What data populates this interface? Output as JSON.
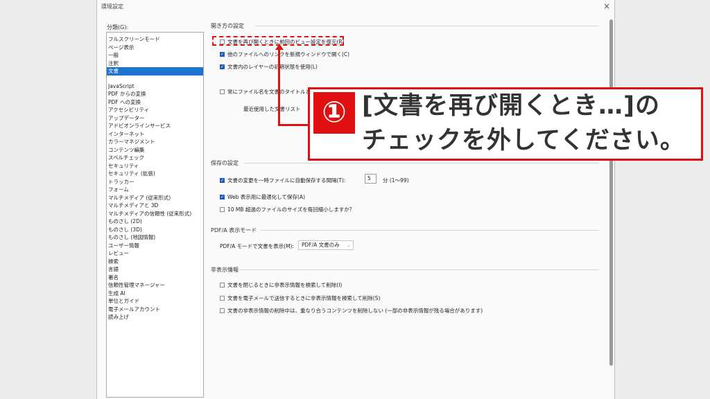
{
  "window": {
    "title": "環境設定",
    "close_glyph": "×"
  },
  "categories": {
    "label": "分類(G):",
    "top_items": [
      "フルスクリーンモード",
      "ページ表示",
      "一般",
      "注釈",
      "文書"
    ],
    "selected": "文書",
    "items": [
      "JavaScript",
      "PDF からの変換",
      "PDF への変換",
      "アクセシビリティ",
      "アップデーター",
      "アドビオンラインサービス",
      "インターネット",
      "カラーマネジメント",
      "コンテンツ編集",
      "スペルチェック",
      "セキュリティ",
      "セキュリティ (拡張)",
      "トラッカー",
      "フォーム",
      "マルチメディア (従来形式)",
      "マルチメディアと 3D",
      "マルチメディアの信頼性 (従来形式)",
      "ものさし (2D)",
      "ものさし (3D)",
      "ものさし (地図情報)",
      "ユーザー情報",
      "レビュー",
      "検索",
      "言語",
      "署名",
      "信頼性管理マネージャー",
      "生成 AI",
      "単位とガイド",
      "電子メールアカウント",
      "読み上げ"
    ]
  },
  "open_settings": {
    "title": "開き方の設定",
    "restore_view": {
      "label": "文書を再び開くときに前回のビュー設定を復元(R)",
      "checked": false
    },
    "open_links_new_window": {
      "label": "他のファイルへのリンクを新規ウィンドウで開く(C)",
      "checked": true
    },
    "use_initial_layer_state": {
      "label": "文書内のレイヤーの初期状態を使用(L)",
      "checked": true
    },
    "show_title_partial": {
      "label": "常にファイル名を文書のタイトルとして",
      "checked": false
    },
    "recent_list_partial": "最近使用した文書リスト"
  },
  "save_settings": {
    "title": "保存の設定",
    "autosave": {
      "label": "文書の変更を一時ファイルに自動保存する間隔(T):",
      "checked": true,
      "value": "5",
      "unit": "分 (1〜99)"
    },
    "web_optimize": {
      "label": "Web 表示用に最適化して保存(A)",
      "checked": true
    },
    "reduce_size": {
      "label": "10 MB 超過のファイルのサイズを毎回縮小しますか？",
      "checked": false
    }
  },
  "pdfa_mode": {
    "title": "PDF/A 表示モード",
    "label": "PDF/A モードで文書を表示(M):",
    "value": "PDF/A 文書のみ"
  },
  "hidden_info": {
    "title": "非表示情報",
    "on_close": {
      "label": "文書を閉じるときに非表示情報を検索して削除(I)",
      "checked": false
    },
    "on_email": {
      "label": "文書を電子メールで送信するときに非表示情報を検索して削除(S)",
      "checked": false
    },
    "no_overlap": {
      "label": "文書の非表示情報の削除中は、重なり合うコンテンツを削除しない (一部の非表示情報が残る場合があります)",
      "checked": false
    }
  },
  "annotation": {
    "number": "①",
    "line1": "[文書を再び開くとき…]の",
    "line2": "チェックを外してください。",
    "color": "#e01010"
  }
}
